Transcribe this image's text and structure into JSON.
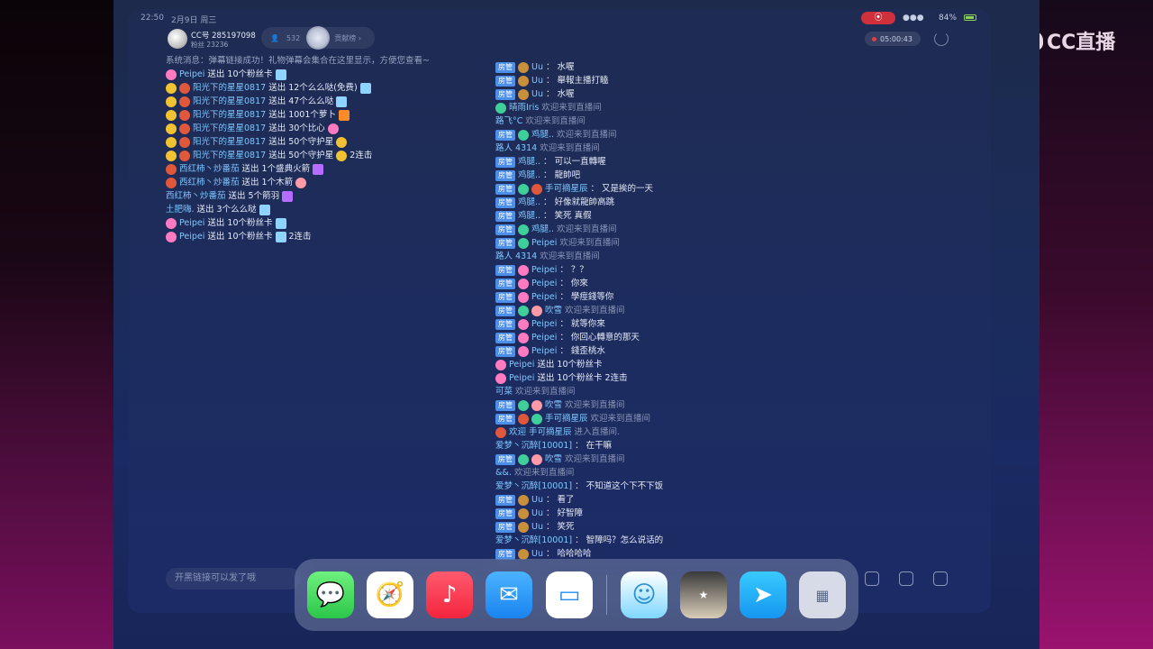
{
  "statusbar": {
    "time": "22:50",
    "date": "2月9日 周三",
    "signal": "●●●",
    "battery": "84%"
  },
  "header": {
    "room_id": "CC号 285197098",
    "fans": "粉丝 23236",
    "viewers": "532",
    "rank_label": "贡献榜 ›",
    "timer": "05:00:43"
  },
  "brand": {
    "logo_text": "CC直播"
  },
  "left_msgs": [
    {
      "type": "sys",
      "text": "系统消息：弹幕链接成功！礼物弹幕会集合在这里显示，方便您查看~"
    },
    {
      "type": "gift",
      "icons": [
        "e-flower"
      ],
      "name": "Peipei",
      "action": "送出 10个粉丝卡",
      "gift": "e-gift",
      "extra": ""
    },
    {
      "type": "gift",
      "icons": [
        "e-sad",
        "e-red"
      ],
      "name": "阳光下的星星0817",
      "action": "送出 12个么么哒(免费)",
      "gift": "e-gift",
      "extra": ""
    },
    {
      "type": "gift",
      "icons": [
        "e-sad",
        "e-red"
      ],
      "name": "阳光下的星星0817",
      "action": "送出 47个么么哒",
      "gift": "e-gift",
      "extra": ""
    },
    {
      "type": "gift",
      "icons": [
        "e-sad",
        "e-red"
      ],
      "name": "阳光下的星星0817",
      "action": "送出 1001个萝卜",
      "gift": "e-carrot",
      "extra": ""
    },
    {
      "type": "gift",
      "icons": [
        "e-sad",
        "e-red"
      ],
      "name": "阳光下的星星0817",
      "action": "送出 30个比心",
      "gift": "e-flower",
      "extra": ""
    },
    {
      "type": "gift",
      "icons": [
        "e-sad",
        "e-red"
      ],
      "name": "阳光下的星星0817",
      "action": "送出 50个守护星",
      "gift": "e-sad",
      "extra": ""
    },
    {
      "type": "gift",
      "icons": [
        "e-sad",
        "e-red"
      ],
      "name": "阳光下的星星0817",
      "action": "送出 50个守护星",
      "gift": "e-sad",
      "extra": "2连击"
    },
    {
      "type": "gift",
      "icons": [
        "e-red"
      ],
      "name": "西红柿丶炒番茄",
      "action": "送出 1个盛典火箭",
      "gift": "e-purple",
      "extra": ""
    },
    {
      "type": "gift",
      "icons": [
        "e-red"
      ],
      "name": "西红柿丶炒番茄",
      "action": "送出 1个木箭",
      "gift": "e-pig",
      "extra": ""
    },
    {
      "type": "gift",
      "icons": [],
      "name": "西红柿丶炒番茄",
      "action": "送出 5个箭羽",
      "gift": "e-purple",
      "extra": ""
    },
    {
      "type": "gift",
      "icons": [],
      "name": "土肥嗨.",
      "action": "送出 3个么么哒",
      "gift": "e-gift",
      "extra": ""
    },
    {
      "type": "gift",
      "icons": [
        "e-flower"
      ],
      "name": "Peipei",
      "action": "送出 10个粉丝卡",
      "gift": "e-gift",
      "extra": ""
    },
    {
      "type": "gift",
      "icons": [
        "e-flower"
      ],
      "name": "Peipei",
      "action": "送出 10个粉丝卡",
      "gift": "e-gift",
      "extra": "2连击"
    }
  ],
  "right_msgs": [
    {
      "badge": "房管",
      "icons": [
        "e-bear"
      ],
      "name": "Uu",
      "sep": "：",
      "text": "水喔",
      "gray": false
    },
    {
      "badge": "房管",
      "icons": [
        "e-bear"
      ],
      "name": "Uu",
      "sep": "：",
      "text": "舉報主播打瞌",
      "gray": false
    },
    {
      "badge": "房管",
      "icons": [
        "e-bear"
      ],
      "name": "Uu",
      "sep": "：",
      "text": "水喔",
      "gray": false
    },
    {
      "badge": "",
      "icons": [
        "e-green"
      ],
      "name": "晴雨Iris",
      "sep": "",
      "text": "欢迎来到直播间",
      "gray": true
    },
    {
      "badge": "",
      "icons": [],
      "name": "路飞°C",
      "sep": "",
      "text": "欢迎来到直播间",
      "gray": true
    },
    {
      "badge": "房管",
      "icons": [
        "e-green"
      ],
      "name": "鸡腿..",
      "sep": "",
      "text": "欢迎来到直播间",
      "gray": true
    },
    {
      "badge": "",
      "icons": [],
      "name": "路人 4314",
      "sep": "",
      "text": "欢迎来到直播间",
      "gray": true
    },
    {
      "badge": "房管",
      "icons": [],
      "name": "鸡腿..",
      "sep": "：",
      "text": "可以一直轉喔",
      "gray": false
    },
    {
      "badge": "房管",
      "icons": [],
      "name": "鸡腿..",
      "sep": "：",
      "text": "龍帥吧",
      "gray": false
    },
    {
      "badge": "房管",
      "icons": [
        "e-green",
        "e-red"
      ],
      "name": "手可摘星辰",
      "sep": "：",
      "text": "又是挨的一天",
      "gray": false
    },
    {
      "badge": "房管",
      "icons": [],
      "name": "鸡腿..",
      "sep": "：",
      "text": "好像就龍帥高跳",
      "gray": false
    },
    {
      "badge": "房管",
      "icons": [],
      "name": "鸡腿..",
      "sep": "：",
      "text": "笑死 真假",
      "gray": false
    },
    {
      "badge": "房管",
      "icons": [
        "e-green"
      ],
      "name": "鸡腿..",
      "sep": "",
      "text": "欢迎来到直播间",
      "gray": true
    },
    {
      "badge": "房管",
      "icons": [
        "e-green"
      ],
      "name": "Peipei",
      "sep": "",
      "text": "欢迎来到直播间",
      "gray": true
    },
    {
      "badge": "",
      "icons": [],
      "name": "路人 4314",
      "sep": "",
      "text": "欢迎来到直播间",
      "gray": true
    },
    {
      "badge": "房管",
      "icons": [
        "e-flower"
      ],
      "name": "Peipei",
      "sep": "：",
      "text": "？？",
      "gray": false
    },
    {
      "badge": "房管",
      "icons": [
        "e-flower"
      ],
      "name": "Peipei",
      "sep": "：",
      "text": "你來",
      "gray": false
    },
    {
      "badge": "房管",
      "icons": [
        "e-flower"
      ],
      "name": "Peipei",
      "sep": "：",
      "text": "學痙錢等你",
      "gray": false
    },
    {
      "badge": "房管",
      "icons": [
        "e-green",
        "e-pig"
      ],
      "name": "吹雪",
      "sep": "",
      "text": "欢迎来到直播间",
      "gray": true
    },
    {
      "badge": "房管",
      "icons": [
        "e-flower"
      ],
      "name": "Peipei",
      "sep": "：",
      "text": "就等你來",
      "gray": false
    },
    {
      "badge": "房管",
      "icons": [
        "e-flower"
      ],
      "name": "Peipei",
      "sep": "：",
      "text": "你回心轉意的那天",
      "gray": false
    },
    {
      "badge": "房管",
      "icons": [
        "e-flower"
      ],
      "name": "Peipei",
      "sep": "：",
      "text": "錢歪桃水",
      "gray": false
    },
    {
      "badge": "",
      "icons": [
        "e-flower"
      ],
      "name": "Peipei",
      "sep": "",
      "text": "送出 10个粉丝卡",
      "gray": false
    },
    {
      "badge": "",
      "icons": [
        "e-flower"
      ],
      "name": "Peipei",
      "sep": "",
      "text": "送出 10个粉丝卡 2连击",
      "gray": false
    },
    {
      "badge": "",
      "icons": [],
      "name": "可菜",
      "sep": "",
      "text": "欢迎来到直播间",
      "gray": true
    },
    {
      "badge": "房管",
      "icons": [
        "e-green",
        "e-pig"
      ],
      "name": "吹雪",
      "sep": "",
      "text": "欢迎来到直播间",
      "gray": true
    },
    {
      "badge": "房管",
      "icons": [
        "e-red",
        "e-green"
      ],
      "name": "手可摘星辰",
      "sep": "",
      "text": "欢迎来到直播间",
      "gray": true
    },
    {
      "badge": "",
      "icons": [
        "e-red"
      ],
      "name": "欢迎 手可摘星辰",
      "sep": "",
      "text": "进入直播间.",
      "gray": true
    },
    {
      "badge": "",
      "icons": [],
      "name": "爱梦丶沉醉[10001]",
      "sep": "：",
      "text": "在干嘛",
      "gray": false
    },
    {
      "badge": "房管",
      "icons": [
        "e-green",
        "e-pig"
      ],
      "name": "吹雪",
      "sep": "",
      "text": "欢迎来到直播间",
      "gray": true
    },
    {
      "badge": "",
      "icons": [],
      "name": "&&.",
      "sep": "",
      "text": "欢迎来到直播间",
      "gray": true
    },
    {
      "badge": "",
      "icons": [],
      "name": "爱梦丶沉醉[10001]",
      "sep": "：",
      "text": "不知道这个下不下饭",
      "gray": false
    },
    {
      "badge": "房管",
      "icons": [
        "e-bear"
      ],
      "name": "Uu",
      "sep": "：",
      "text": "看了",
      "gray": false
    },
    {
      "badge": "房管",
      "icons": [
        "e-bear"
      ],
      "name": "Uu",
      "sep": "：",
      "text": "好智障",
      "gray": false
    },
    {
      "badge": "房管",
      "icons": [
        "e-bear"
      ],
      "name": "Uu",
      "sep": "：",
      "text": "笑死",
      "gray": false
    },
    {
      "badge": "",
      "icons": [],
      "name": "爱梦丶沉醉[10001]",
      "sep": "：",
      "text": "智障吗？怎么说话的",
      "gray": false
    },
    {
      "badge": "房管",
      "icons": [
        "e-bear"
      ],
      "name": "Uu",
      "sep": "：",
      "text": "哈哈哈哈",
      "gray": false
    }
  ],
  "input": {
    "placeholder": "开黑链接可以发了哦"
  },
  "dock": {
    "apps": [
      {
        "name": "messages-app",
        "glyph": "💬"
      },
      {
        "name": "safari-app",
        "glyph": "🧭"
      },
      {
        "name": "music-app",
        "glyph": "♪"
      },
      {
        "name": "mail-app",
        "glyph": "✉"
      },
      {
        "name": "files-app",
        "glyph": "▭"
      },
      {
        "name": "game1-app",
        "glyph": "☺"
      },
      {
        "name": "game2-app",
        "glyph": "★"
      },
      {
        "name": "swift-app",
        "glyph": "➤"
      },
      {
        "name": "app-library",
        "glyph": "▦"
      }
    ]
  }
}
